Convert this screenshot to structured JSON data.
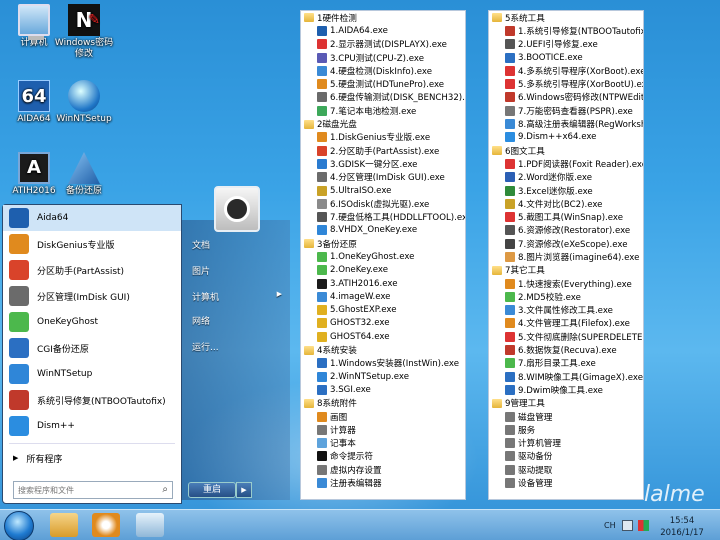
{
  "desktop_icons": [
    {
      "label": "计算机",
      "icon": "computer-icon"
    },
    {
      "label": "Windows密码修改",
      "icon": "ntpw-icon"
    },
    {
      "label": "AIDA64",
      "icon": "aida64-icon"
    },
    {
      "label": "WinNTSetup",
      "icon": "winntsetup-icon"
    },
    {
      "label": "ATIH2016",
      "icon": "atih-icon"
    },
    {
      "label": "备份还原",
      "icon": "cgi-icon"
    }
  ],
  "start_menu": {
    "items": [
      {
        "label": "Aida64",
        "icon": "aida64-icon",
        "color": "#1e5fae"
      },
      {
        "label": "DiskGenius专业版",
        "icon": "diskgenius-icon",
        "color": "#e08a1e"
      },
      {
        "label": "分区助手(PartAssist)",
        "icon": "partassist-icon",
        "color": "#d9432a"
      },
      {
        "label": "分区管理(ImDisk GUI)",
        "icon": "imdisk-icon",
        "color": "#6b6b6b"
      },
      {
        "label": "OneKeyGhost",
        "icon": "onekeyghost-icon",
        "color": "#4cb84c"
      },
      {
        "label": "CGI备份还原",
        "icon": "cgi-icon",
        "color": "#2b6fc2"
      },
      {
        "label": "WinNTSetup",
        "icon": "winntsetup-icon",
        "color": "#2f86d8"
      },
      {
        "label": "系统引导修复(NTBOOTautofix)",
        "icon": "ntboot-icon",
        "color": "#c0392b"
      },
      {
        "label": "Dism++",
        "icon": "dism-icon",
        "color": "#2b8de0"
      }
    ],
    "all_programs": "所有程序",
    "search_placeholder": "搜索程序和文件",
    "right_pane": [
      "文档",
      "图片",
      "计算机",
      "网络",
      "运行..."
    ],
    "shutdown": "重启"
  },
  "panel_left": [
    {
      "type": "folder",
      "label": "1硬件检测"
    },
    {
      "type": "file",
      "label": "1.AIDA64.exe",
      "color": "#1e5fae"
    },
    {
      "type": "file",
      "label": "2.显示器测试(DISPLAYX).exe",
      "color": "#d33"
    },
    {
      "type": "file",
      "label": "3.CPU测试(CPU-Z).exe",
      "color": "#5a5ab5"
    },
    {
      "type": "file",
      "label": "4.硬盘检测(DiskInfo).exe",
      "color": "#3a8ad6"
    },
    {
      "type": "file",
      "label": "5.硬盘测试(HDTunePro).exe",
      "color": "#e08a1e"
    },
    {
      "type": "file",
      "label": "6.硬盘传输测试(DISK_BENCH32).exe",
      "color": "#6a6a6a"
    },
    {
      "type": "file",
      "label": "7.笔记本电池检测.exe",
      "color": "#3da85a"
    },
    {
      "type": "folder",
      "label": "2磁盘光盘"
    },
    {
      "type": "file",
      "label": "1.DiskGenius专业版.exe",
      "color": "#e08a1e"
    },
    {
      "type": "file",
      "label": "2.分区助手(PartAssist).exe",
      "color": "#d9432a"
    },
    {
      "type": "file",
      "label": "3.GDISK一键分区.exe",
      "color": "#2a7bd0"
    },
    {
      "type": "file",
      "label": "4.分区管理(ImDisk GUI).exe",
      "color": "#6b6b6b"
    },
    {
      "type": "file",
      "label": "5.UltraISO.exe",
      "color": "#c9a227"
    },
    {
      "type": "file",
      "label": "6.ISOdisk(虚拟光驱).exe",
      "color": "#8a8a8a"
    },
    {
      "type": "file",
      "label": "7.硬盘低格工具(HDDLLFTOOL).exe",
      "color": "#555"
    },
    {
      "type": "file",
      "label": "8.VHDX_OneKey.exe",
      "color": "#2f86d8"
    },
    {
      "type": "folder",
      "label": "3备份还原"
    },
    {
      "type": "file",
      "label": "1.OneKeyGhost.exe",
      "color": "#4cb84c"
    },
    {
      "type": "file",
      "label": "2.OneKey.exe",
      "color": "#4cb84c"
    },
    {
      "type": "file",
      "label": "3.ATIH2016.exe",
      "color": "#1b1b1b"
    },
    {
      "type": "file",
      "label": "4.imageW.exe",
      "color": "#3a8ad6"
    },
    {
      "type": "file",
      "label": "5.GhostEXP.exe",
      "color": "#e0b020"
    },
    {
      "type": "file",
      "label": "GHOST32.exe",
      "color": "#e0b020"
    },
    {
      "type": "file",
      "label": "GHOST64.exe",
      "color": "#e0b020"
    },
    {
      "type": "folder",
      "label": "4系统安装"
    },
    {
      "type": "file",
      "label": "1.Windows安装器(InstWin).exe",
      "color": "#2b6fc2"
    },
    {
      "type": "file",
      "label": "2.WinNTSetup.exe",
      "color": "#2f86d8"
    },
    {
      "type": "file",
      "label": "3.SGI.exe",
      "color": "#2b6fc2"
    },
    {
      "type": "folder",
      "label": "8系统附件"
    },
    {
      "type": "file",
      "label": "画图",
      "color": "#e08a1e"
    },
    {
      "type": "file",
      "label": "计算器",
      "color": "#777"
    },
    {
      "type": "file",
      "label": "记事本",
      "color": "#5ea3dc"
    },
    {
      "type": "file",
      "label": "命令提示符",
      "color": "#111"
    },
    {
      "type": "file",
      "label": "虚拟内存设置",
      "color": "#777"
    },
    {
      "type": "file",
      "label": "注册表编辑器",
      "color": "#3a8ad6"
    }
  ],
  "panel_right": [
    {
      "type": "folder",
      "label": "5系统工具"
    },
    {
      "type": "file",
      "label": "1.系统引导修复(NTBOOTautofix).exe",
      "color": "#c0392b"
    },
    {
      "type": "file",
      "label": "2.UEFI引导修复.exe",
      "color": "#555"
    },
    {
      "type": "file",
      "label": "3.BOOTICE.exe",
      "color": "#2b6fc2"
    },
    {
      "type": "file",
      "label": "4.多系统引导程序(XorBoot).exe",
      "color": "#d33"
    },
    {
      "type": "file",
      "label": "5.多系统引导程序(XorBootU).exe",
      "color": "#d33"
    },
    {
      "type": "file",
      "label": "6.Windows密码修改(NTPWEdit).exe",
      "color": "#c0392b"
    },
    {
      "type": "file",
      "label": "7.万能密码查看器(PSPR).exe",
      "color": "#777"
    },
    {
      "type": "file",
      "label": "8.高级注册表编辑器(RegWorkshop).exe",
      "color": "#3a8ad6"
    },
    {
      "type": "file",
      "label": "9.Dism++x64.exe",
      "color": "#2b8de0"
    },
    {
      "type": "folder",
      "label": "6图文工具"
    },
    {
      "type": "file",
      "label": "1.PDF阅读器(Foxit Reader).exe",
      "color": "#d33"
    },
    {
      "type": "file",
      "label": "2.Word迷你版.exe",
      "color": "#2b5fb5"
    },
    {
      "type": "file",
      "label": "3.Excel迷你版.exe",
      "color": "#2f8a3a"
    },
    {
      "type": "file",
      "label": "4.文件对比(BC2).exe",
      "color": "#c9a227"
    },
    {
      "type": "file",
      "label": "5.截图工具(WinSnap).exe",
      "color": "#d33"
    },
    {
      "type": "file",
      "label": "6.资源修改(Restorator).exe",
      "color": "#555"
    },
    {
      "type": "file",
      "label": "7.资源修改(eXeScope).exe",
      "color": "#444"
    },
    {
      "type": "file",
      "label": "8.图片浏览器(imagine64).exe",
      "color": "#d94"
    },
    {
      "type": "folder",
      "label": "7其它工具"
    },
    {
      "type": "file",
      "label": "1.快速搜索(Everything).exe",
      "color": "#e08a1e"
    },
    {
      "type": "file",
      "label": "2.MD5校验.exe",
      "color": "#4cb84c"
    },
    {
      "type": "file",
      "label": "3.文件属性修改工具.exe",
      "color": "#3a8ad6"
    },
    {
      "type": "file",
      "label": "4.文件管理工具(Filefox).exe",
      "color": "#e08a1e"
    },
    {
      "type": "file",
      "label": "5.文件彻底删除(SUPERDELETE).exe",
      "color": "#d33"
    },
    {
      "type": "file",
      "label": "6.数据恢复(Recuva).exe",
      "color": "#c0392b"
    },
    {
      "type": "file",
      "label": "7.扇形目录工具.exe",
      "color": "#4cb84c"
    },
    {
      "type": "file",
      "label": "8.WIM映像工具(GimageX).exe",
      "color": "#2b6fc2"
    },
    {
      "type": "file",
      "label": "9.Dwim映像工具.exe",
      "color": "#2b6fc2"
    },
    {
      "type": "folder",
      "label": "9管理工具"
    },
    {
      "type": "file",
      "label": "磁盘管理",
      "color": "#777"
    },
    {
      "type": "file",
      "label": "服务",
      "color": "#777"
    },
    {
      "type": "file",
      "label": "计算机管理",
      "color": "#777"
    },
    {
      "type": "file",
      "label": "驱动备份",
      "color": "#777"
    },
    {
      "type": "file",
      "label": "驱动提取",
      "color": "#777"
    },
    {
      "type": "file",
      "label": "设备管理",
      "color": "#777"
    }
  ],
  "taskbar": {
    "lang": "CH",
    "time": "15:54",
    "date": "2016/1/17"
  },
  "watermark": "lalme"
}
